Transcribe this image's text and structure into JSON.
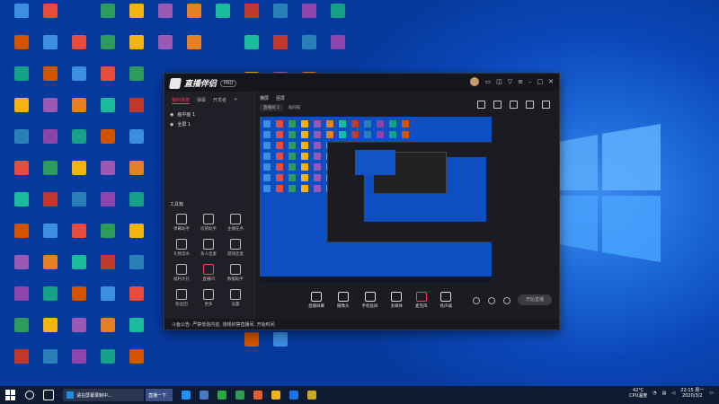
{
  "app": {
    "name": "直播伴侣",
    "version": "PRO",
    "sidebar_tabs": [
      "我的场景",
      "弹幕",
      "开发者"
    ],
    "scenes": [
      "画中画 1",
      "全屏 1"
    ],
    "tools_title": "工具箱",
    "tools": [
      "弹幕助手",
      "房管助手",
      "主播任务",
      "礼物流水",
      "多人连麦",
      "游戏连麦",
      "福利大礼",
      "直播间",
      "数据助手",
      "粉丝团",
      "更多",
      "设置"
    ],
    "top_tabs": [
      "横屏",
      "竖屏"
    ],
    "room_label": "直播间 1",
    "room_tag": "房间号",
    "bottom_tools": [
      "直播屏幕",
      "摄像头",
      "手机投屏",
      "多媒体",
      "麦克风",
      "扬声器"
    ],
    "live_button": "开始直播",
    "notice": "斗鱼公告: 严禁低俗内容, 违规封禁直播间, 开始时间"
  },
  "taskbar": {
    "task_label": "请在屏幕录制中...",
    "task_label2": "直播一下",
    "weather": "42°C",
    "weather_sub": "CPU温度",
    "time": "22:15 周一",
    "date": "2020/3/2"
  },
  "colors": {
    "accent": "#ff3b5c",
    "desktop": "#0b46b8"
  }
}
